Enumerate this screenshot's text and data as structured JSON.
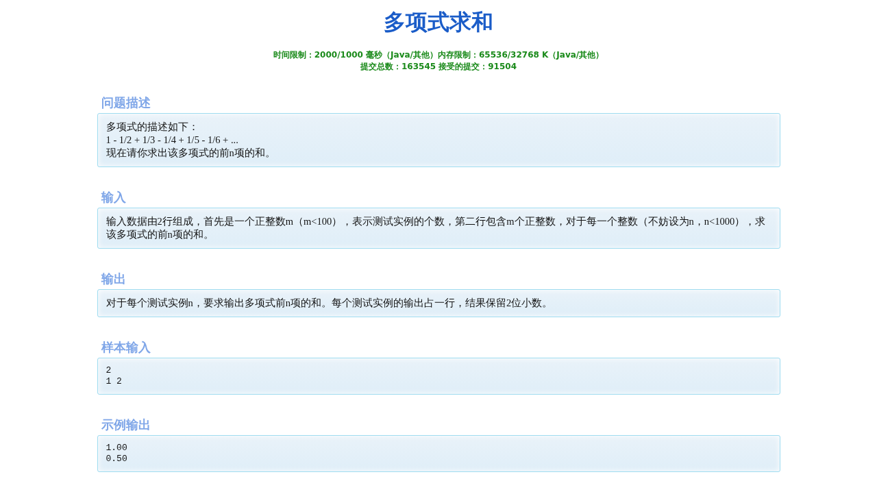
{
  "title": "多项式求和",
  "limits": [
    "时间限制：2000/1000 毫秒（Java/其他）内存限制：65536/32768 K（Java/其他）",
    "提交总数：163545 接受的提交：91504"
  ],
  "sections": [
    {
      "heading": "问题描述",
      "kind": "text",
      "lines": [
        "多项式的描述如下：",
        "1 - 1/2 + 1/3 - 1/4 + 1/5 - 1/6 + ...",
        "现在请你求出该多项式的前n项的和。"
      ]
    },
    {
      "heading": "输入",
      "kind": "text",
      "lines": [
        "输入数据由2行组成，首先是一个正整数m（m<100），表示测试实例的个数，第二行包含m个正整数，对于每一个整数（不妨设为n，n<1000），求该多项式的前n项的和。"
      ]
    },
    {
      "heading": "输出",
      "kind": "text",
      "lines": [
        "对于每个测试实例n，要求输出多项式前n项的和。每个测试实例的输出占一行，结果保留2位小数。"
      ]
    },
    {
      "heading": "样本输入",
      "kind": "code",
      "lines": [
        "2",
        "1 2"
      ]
    },
    {
      "heading": "示例输出",
      "kind": "code",
      "lines": [
        "1.00",
        "0.50"
      ]
    }
  ]
}
